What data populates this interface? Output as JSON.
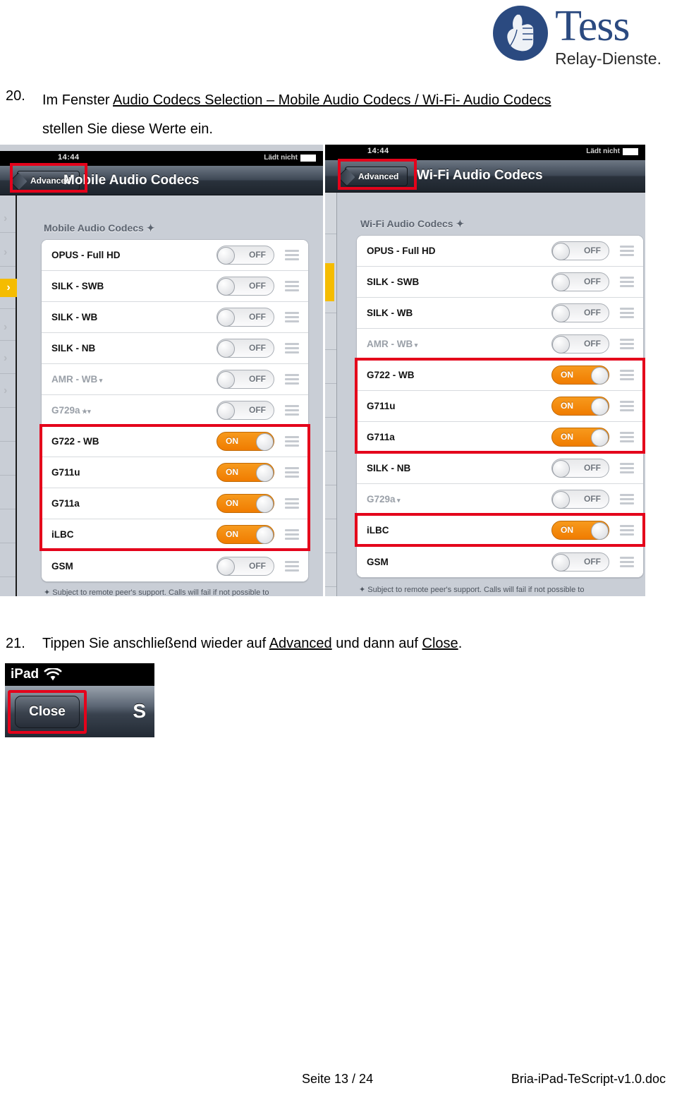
{
  "brand": {
    "name": "Tess",
    "tagline": "Relay-Dienste.",
    "logo_color": "#2b4a80"
  },
  "steps": [
    {
      "number": "20.",
      "line1_prefix": "Im Fenster ",
      "line1_underlined": "Audio Codecs Selection – Mobile Audio Codecs / Wi-Fi- Audio Codecs",
      "line2": "stellen Sie diese Werte ein."
    },
    {
      "number": "21.",
      "prefix": "Tippen Sie anschließend wieder auf ",
      "link1": "Advanced",
      "middle": " und dann auf ",
      "link2": "Close",
      "suffix": "."
    }
  ],
  "devices": [
    {
      "id": "mobile",
      "status": {
        "time": "14:44",
        "battery_text": "Lädt nicht"
      },
      "nav": {
        "back_label": "Advanced",
        "title": "Mobile Audio Codecs"
      },
      "section_label": "Mobile Audio Codecs ✦",
      "footnote": "✦ Subject to remote peer's support. Calls will fail if not possible to",
      "rows": [
        {
          "label": "OPUS - Full HD",
          "state": "OFF",
          "dim": false,
          "caret": ""
        },
        {
          "label": "SILK - SWB",
          "state": "OFF",
          "dim": false,
          "caret": ""
        },
        {
          "label": "SILK - WB",
          "state": "OFF",
          "dim": false,
          "caret": ""
        },
        {
          "label": "SILK - NB",
          "state": "OFF",
          "dim": false,
          "caret": ""
        },
        {
          "label": "AMR - WB",
          "state": "OFF",
          "dim": true,
          "caret": "▾"
        },
        {
          "label": "G729a",
          "state": "OFF",
          "dim": true,
          "caret": "★▾"
        },
        {
          "label": "G722 - WB",
          "state": "ON",
          "dim": false,
          "caret": ""
        },
        {
          "label": "G711u",
          "state": "ON",
          "dim": false,
          "caret": ""
        },
        {
          "label": "G711a",
          "state": "ON",
          "dim": false,
          "caret": ""
        },
        {
          "label": "iLBC",
          "state": "ON",
          "dim": false,
          "caret": ""
        },
        {
          "label": "GSM",
          "state": "OFF",
          "dim": false,
          "caret": ""
        }
      ],
      "highlighted_rows": [
        [
          6,
          9
        ]
      ]
    },
    {
      "id": "wifi",
      "status": {
        "time": "14:44",
        "battery_text": "Lädt nicht"
      },
      "nav": {
        "back_label": "Advanced",
        "title": "Wi-Fi Audio Codecs"
      },
      "section_label": "Wi-Fi Audio Codecs ✦",
      "footnote": "✦ Subject to remote peer's support. Calls will fail if not possible to",
      "rows": [
        {
          "label": "OPUS - Full HD",
          "state": "OFF",
          "dim": false,
          "caret": ""
        },
        {
          "label": "SILK - SWB",
          "state": "OFF",
          "dim": false,
          "caret": ""
        },
        {
          "label": "SILK - WB",
          "state": "OFF",
          "dim": false,
          "caret": ""
        },
        {
          "label": "AMR - WB",
          "state": "OFF",
          "dim": true,
          "caret": "▾"
        },
        {
          "label": "G722 - WB",
          "state": "ON",
          "dim": false,
          "caret": ""
        },
        {
          "label": "G711u",
          "state": "ON",
          "dim": false,
          "caret": ""
        },
        {
          "label": "G711a",
          "state": "ON",
          "dim": false,
          "caret": ""
        },
        {
          "label": "SILK - NB",
          "state": "OFF",
          "dim": false,
          "caret": ""
        },
        {
          "label": "G729a",
          "state": "OFF",
          "dim": true,
          "caret": "▾"
        },
        {
          "label": "iLBC",
          "state": "ON",
          "dim": false,
          "caret": ""
        },
        {
          "label": "GSM",
          "state": "OFF",
          "dim": false,
          "caret": ""
        }
      ],
      "highlighted_rows": [
        [
          4,
          6
        ],
        [
          9,
          9
        ]
      ]
    }
  ],
  "close_shot": {
    "device_label": "iPad",
    "wifi_icon": "wifi-icon",
    "close_label": "Close",
    "partial_label": "S"
  },
  "footer": {
    "page": "Seite 13 / 24",
    "document": "Bria-iPad-TeScript-v1.0.doc"
  },
  "accent_colors": {
    "highlight_red": "#e4031b",
    "toggle_on": "#f08400",
    "sidebar_selected": "#f5bc00"
  }
}
